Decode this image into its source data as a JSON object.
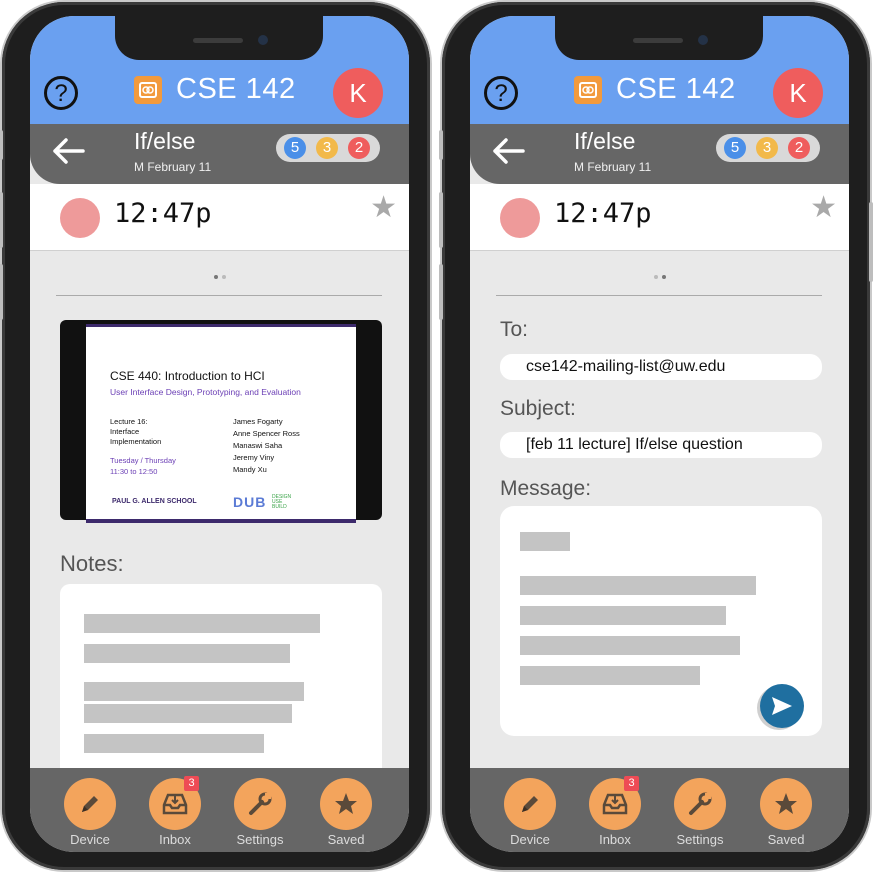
{
  "header": {
    "course_title": "CSE 142",
    "avatar_initial": "K",
    "help_glyph": "?"
  },
  "lecture": {
    "title": "If/else",
    "date": "M February 11",
    "counts": [
      {
        "value": "5",
        "color": "#4a8fe8"
      },
      {
        "value": "3",
        "color": "#f2b94a"
      },
      {
        "value": "2",
        "color": "#ef5d5d"
      }
    ]
  },
  "recording": {
    "time": "12:47p"
  },
  "slide": {
    "title": "CSE 440: Introduction to HCI",
    "subtitle": "User Interface Design, Prototyping, and Evaluation",
    "lecture_label": "Lecture 16:\nInterface\nImplementation",
    "schedule": "Tuesday / Thursday\n11:30 to 12:50",
    "names": "James Fogarty\nAnne Spencer Ross\nManaswi Saha\nJeremy Viny\nMandy Xu",
    "school": "PAUL G. ALLEN SCHOOL",
    "dub": "DUB",
    "dub_tag": "DESIGN\nUSE\nBUILD"
  },
  "notes": {
    "label": "Notes:"
  },
  "email": {
    "to_label": "To:",
    "to_value": "cse142-mailing-list@uw.edu",
    "subject_label": "Subject:",
    "subject_value": "[feb 11 lecture] If/else question",
    "message_label": "Message:"
  },
  "tabbar": {
    "items": [
      {
        "label": "Device",
        "icon": "pencil-icon"
      },
      {
        "label": "Inbox",
        "icon": "inbox-icon",
        "badge": "3"
      },
      {
        "label": "Settings",
        "icon": "wrench-icon"
      },
      {
        "label": "Saved",
        "icon": "star-icon"
      }
    ]
  },
  "colors": {
    "header_blue": "#6aa0f0",
    "bar_gray": "#666666",
    "accent_orange": "#f3a45c",
    "record_pink": "#ee9a9a",
    "send_blue": "#1f6fa0"
  }
}
